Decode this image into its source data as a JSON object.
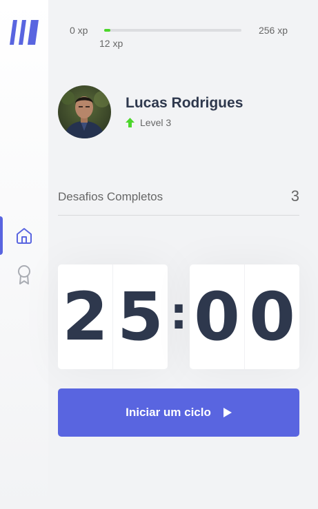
{
  "sidebar": {
    "logo_icon": "app-logo-icon",
    "items": [
      {
        "icon": "home-icon",
        "active": true
      },
      {
        "icon": "award-icon",
        "active": false
      }
    ],
    "accent_color": "#5965e0"
  },
  "xp": {
    "min_label": "0 xp",
    "max_label": "256 xp",
    "current_label": "12 xp",
    "progress_fraction": 0.047,
    "bar_color": "#4cd62b"
  },
  "profile": {
    "name": "Lucas Rodrigues",
    "level_label": "Level 3",
    "level_icon": "level-up-arrow-icon"
  },
  "challenges": {
    "label": "Desafios Completos",
    "count": "3"
  },
  "countdown": {
    "minute_left": "2",
    "minute_right": "5",
    "separator": ":",
    "second_left": "0",
    "second_right": "0"
  },
  "start_button": {
    "label": "Iniciar um ciclo",
    "icon": "play-icon",
    "color": "#5965e0"
  }
}
